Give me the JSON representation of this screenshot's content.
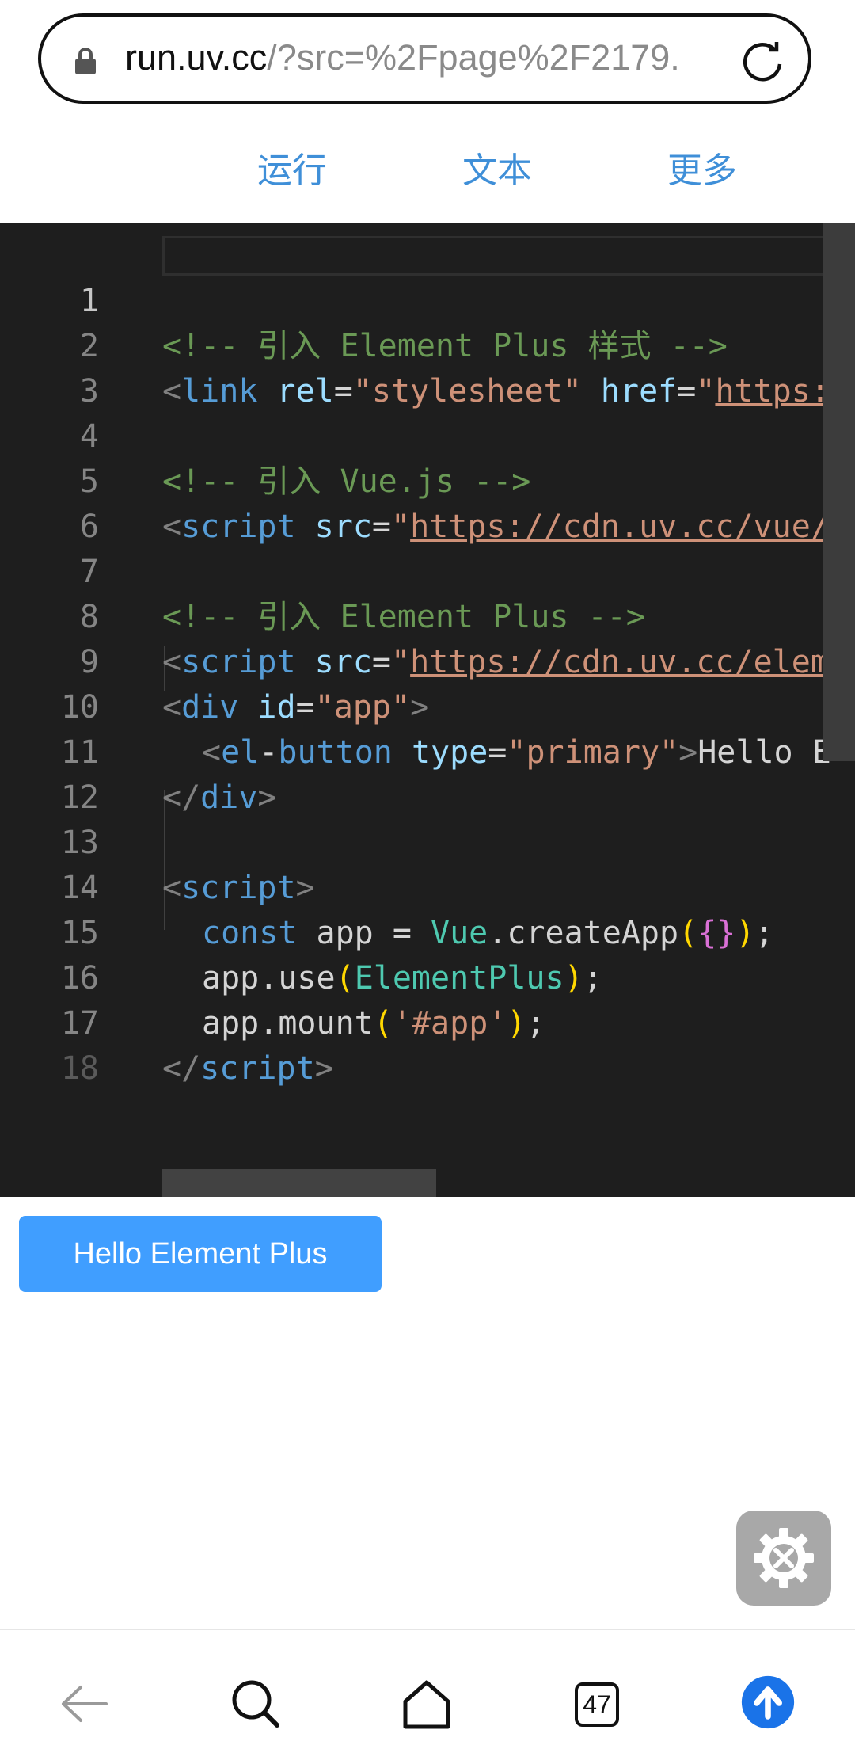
{
  "browser": {
    "url_host": "run.uv.cc",
    "url_rest": "/?src=%2Fpage%2F2179."
  },
  "tabs": [
    {
      "label": "运行"
    },
    {
      "label": "文本"
    },
    {
      "label": "更多"
    }
  ],
  "editor": {
    "line_numbers": [
      "1",
      "2",
      "3",
      "4",
      "5",
      "6",
      "7",
      "8",
      "9",
      "10",
      "11",
      "12",
      "13",
      "14",
      "15",
      "16",
      "17",
      "18"
    ],
    "lines": {
      "l1": {
        "text": "<!-- 引入 Element Plus 样式 -->"
      },
      "l2": {
        "brk1": "<",
        "tag": "link",
        "attr1": " rel",
        "eq1": "=",
        "val1": "\"stylesheet\"",
        "attr2": " href",
        "eq2": "=",
        "q": "\"",
        "url": "https:"
      },
      "l4": {
        "text": "<!-- 引入 Vue.js -->"
      },
      "l5": {
        "brk1": "<",
        "tag": "script",
        "attr1": " src",
        "eq1": "=",
        "q": "\"",
        "url": "https://cdn.uv.cc/vue/"
      },
      "l7": {
        "text": "<!-- 引入 Element Plus -->"
      },
      "l8": {
        "brk1": "<",
        "tag": "script",
        "attr1": " src",
        "eq1": "=",
        "q": "\"",
        "url": "https://cdn.uv.cc/elem"
      },
      "l9": {
        "brk1": "<",
        "tag": "div",
        "attr1": " id",
        "eq1": "=",
        "val1": "\"app\"",
        "brk2": ">"
      },
      "l10": {
        "brk1": "<",
        "tag1": "el",
        "dash": "-",
        "tag2": "button",
        "attr1": " type",
        "eq1": "=",
        "val1": "\"primary\"",
        "brk2": ">",
        "text": "Hello E"
      },
      "l11": {
        "brk1": "</",
        "tag": "div",
        "brk2": ">"
      },
      "l13": {
        "brk1": "<",
        "tag": "script",
        "brk2": ">"
      },
      "l14": {
        "kw": "const",
        "sp": " app = ",
        "cls": "Vue",
        "dot": ".",
        "fn": "createApp",
        "p1": "(",
        "p2": "{}",
        "p3": ")",
        "end": ";"
      },
      "l15": {
        "obj": "app",
        "dot": ".",
        "fn": "use",
        "p1": "(",
        "cls": "ElementPlus",
        "p2": ")",
        "end": ";"
      },
      "l16": {
        "obj": "app",
        "dot": ".",
        "fn": "mount",
        "p1": "(",
        "str": "'#app'",
        "p2": ")",
        "end": ";"
      },
      "l17": {
        "brk1": "</",
        "tag": "script",
        "brk2": ">"
      }
    }
  },
  "preview": {
    "button_label": "Hello Element Plus",
    "button_color": "#409eff"
  },
  "fab": {
    "icon": "tools-gear-icon"
  },
  "bottom_nav": {
    "tab_count": "47",
    "icons": [
      "back-arrow-icon",
      "search-icon",
      "home-icon",
      "tabs-icon",
      "upload-icon"
    ],
    "accent": "#1a73e8"
  }
}
